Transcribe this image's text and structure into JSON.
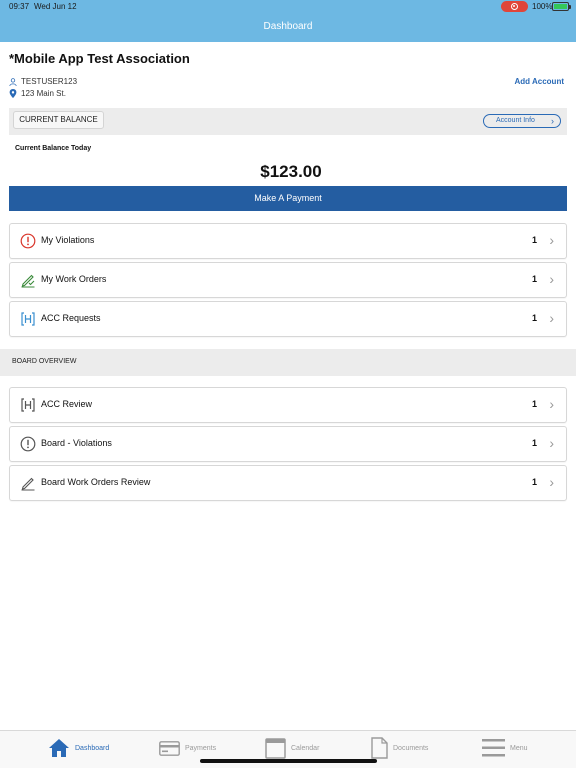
{
  "status": {
    "time": "09:37",
    "date": "Wed Jun 12",
    "battery": "100%",
    "battery_level": 1.0
  },
  "header": {
    "title": "Dashboard"
  },
  "account": {
    "name": "*Mobile App Test Association",
    "user": "TESTUSER123",
    "address": "123 Main St.",
    "add_account": "Add Account"
  },
  "balance": {
    "chip": "CURRENT BALANCE",
    "account_info": "Account Info",
    "today_label": "Current Balance Today",
    "amount": "$123.00",
    "pay_button": "Make A Payment"
  },
  "items": [
    {
      "label": "My Violations",
      "count": "1",
      "icon": "alert-circle-icon"
    },
    {
      "label": "My Work Orders",
      "count": "1",
      "icon": "pen-check-icon"
    },
    {
      "label": "ACC Requests",
      "count": "1",
      "icon": "bracket-icon"
    }
  ],
  "board": {
    "header": "BOARD OVERVIEW",
    "items": [
      {
        "label": "ACC Review",
        "count": "1",
        "icon": "bracket-icon"
      },
      {
        "label": "Board - Violations",
        "count": "1",
        "icon": "alert-circle-icon"
      },
      {
        "label": "Board Work Orders Review",
        "count": "1",
        "icon": "pen-icon"
      }
    ]
  },
  "tabs": [
    {
      "label": "Dashboard",
      "icon": "home-icon",
      "active": true
    },
    {
      "label": "Payments",
      "icon": "card-icon",
      "active": false
    },
    {
      "label": "Calendar",
      "icon": "calendar-icon",
      "active": false
    },
    {
      "label": "Documents",
      "icon": "document-icon",
      "active": false
    },
    {
      "label": "Menu",
      "icon": "menu-icon",
      "active": false
    }
  ],
  "colors": {
    "accent": "#245da1",
    "link": "#2a6ab6",
    "header_bg": "#6db8e3",
    "alert": "#d9362b",
    "success": "#3a8a3a"
  }
}
